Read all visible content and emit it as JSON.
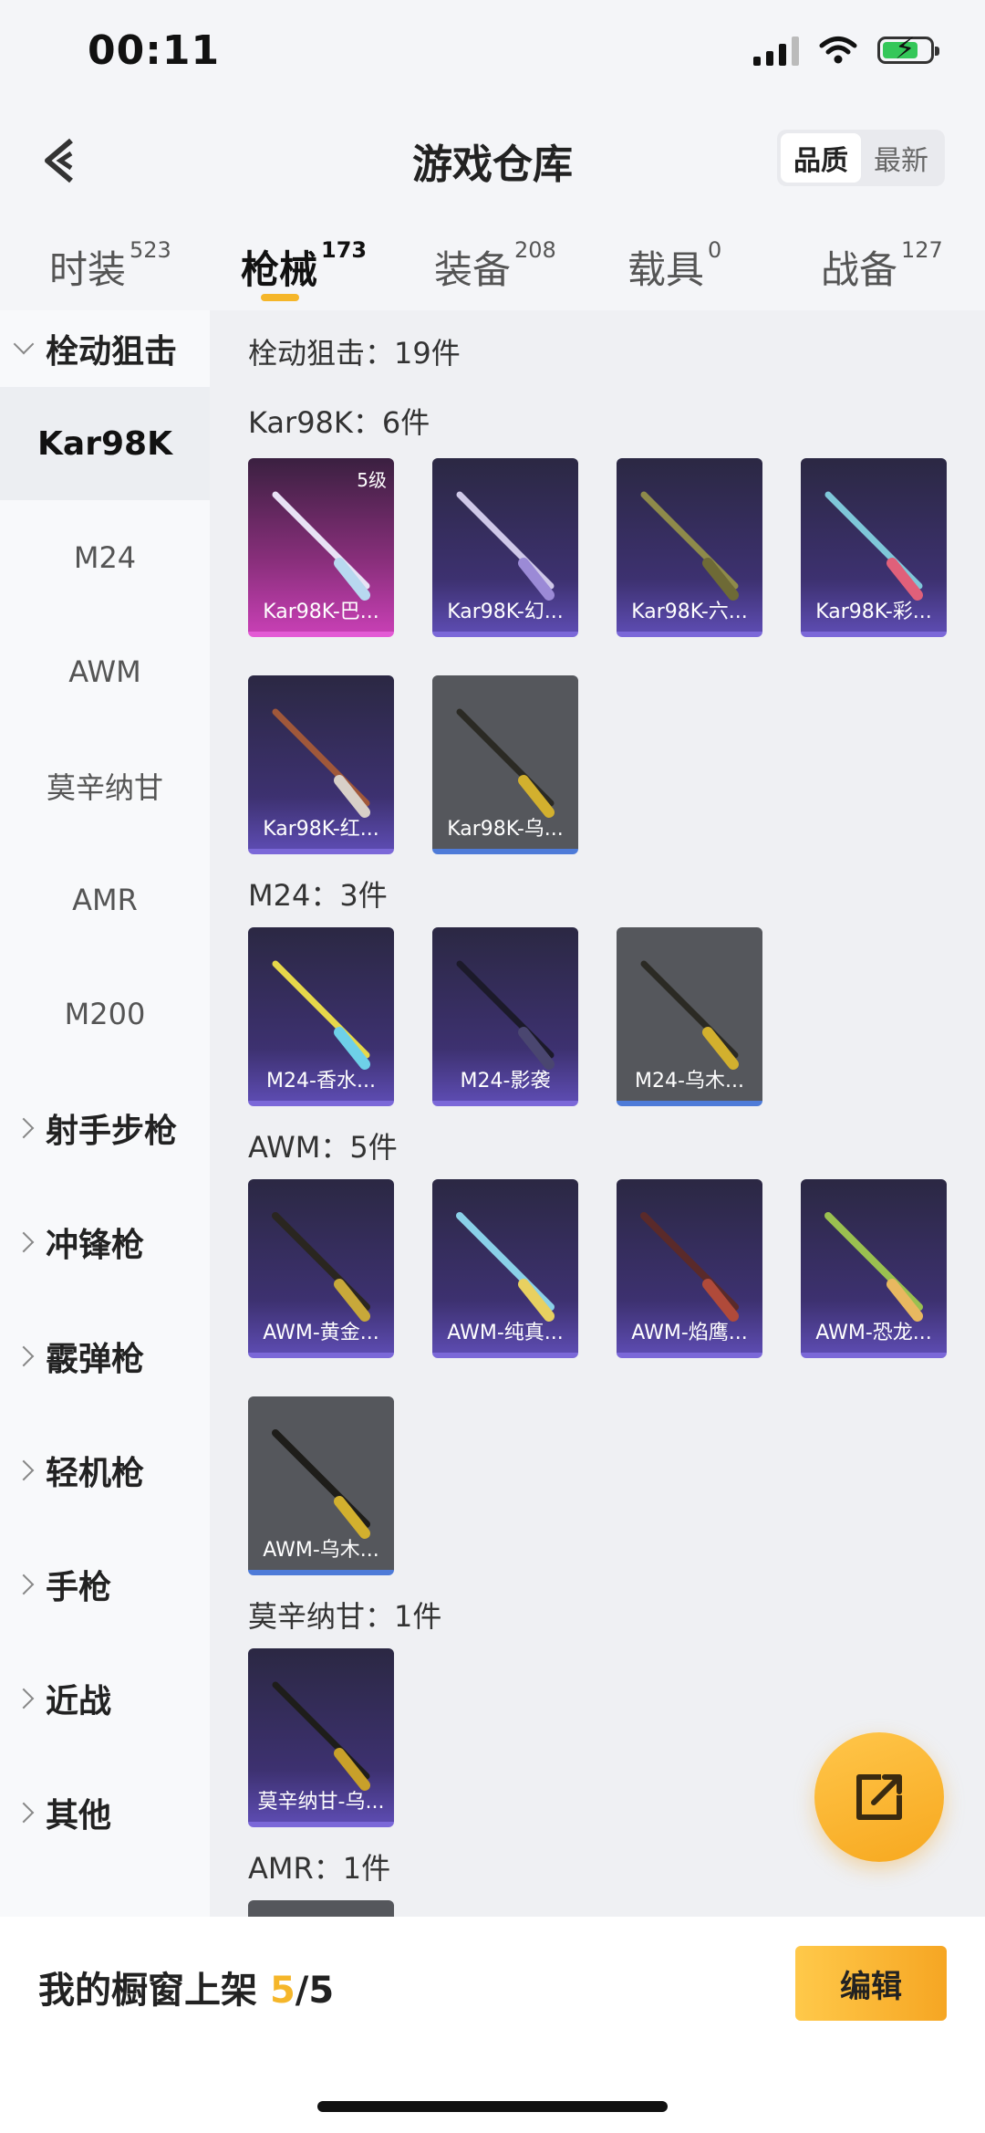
{
  "status_bar": {
    "time": "00:11"
  },
  "header": {
    "title": "游戏仓库",
    "sort_quality": "品质",
    "sort_newest": "最新"
  },
  "tabs": [
    {
      "label": "时装",
      "count": "523"
    },
    {
      "label": "枪械",
      "count": "173"
    },
    {
      "label": "装备",
      "count": "208"
    },
    {
      "label": "载具",
      "count": "0"
    },
    {
      "label": "战备",
      "count": "127"
    }
  ],
  "sidebar": {
    "expanded_category": "栓动狙击",
    "sub_items": [
      "Kar98K",
      "M24",
      "AWM",
      "莫辛纳甘",
      "AMR",
      "M200"
    ],
    "categories": [
      "射手步枪",
      "冲锋枪",
      "霰弹枪",
      "轻机枪",
      "手枪",
      "近战",
      "其他"
    ]
  },
  "main": {
    "total_label": "栓动狙击：19件",
    "sections": [
      {
        "label": "Kar98K：6件"
      },
      {
        "label": "M24：3件"
      },
      {
        "label": "AWM：5件"
      },
      {
        "label": "莫辛纳甘：1件"
      },
      {
        "label": "AMR：1件"
      }
    ],
    "items": [
      {
        "name": "Kar98K-巴...",
        "level": "5级"
      },
      {
        "name": "Kar98K-幻..."
      },
      {
        "name": "Kar98K-六..."
      },
      {
        "name": "Kar98K-彩..."
      },
      {
        "name": "Kar98K-红..."
      },
      {
        "name": "Kar98K-乌..."
      },
      {
        "name": "M24-香水..."
      },
      {
        "name": "M24-影袭"
      },
      {
        "name": "M24-乌木..."
      },
      {
        "name": "AWM-黄金..."
      },
      {
        "name": "AWM-纯真..."
      },
      {
        "name": "AWM-焰鹰..."
      },
      {
        "name": "AWM-恐龙..."
      },
      {
        "name": "AWM-乌木..."
      },
      {
        "name": "莫辛纳甘-乌..."
      }
    ]
  },
  "bottom_bar": {
    "label": "我的橱窗上架",
    "current": "5",
    "total": "/5",
    "edit_label": "编辑"
  },
  "colors": {
    "accent": "#f5b62a",
    "card_purple": "#3d3170",
    "card_pink": "#c63fb3",
    "card_gray": "#55575c"
  }
}
